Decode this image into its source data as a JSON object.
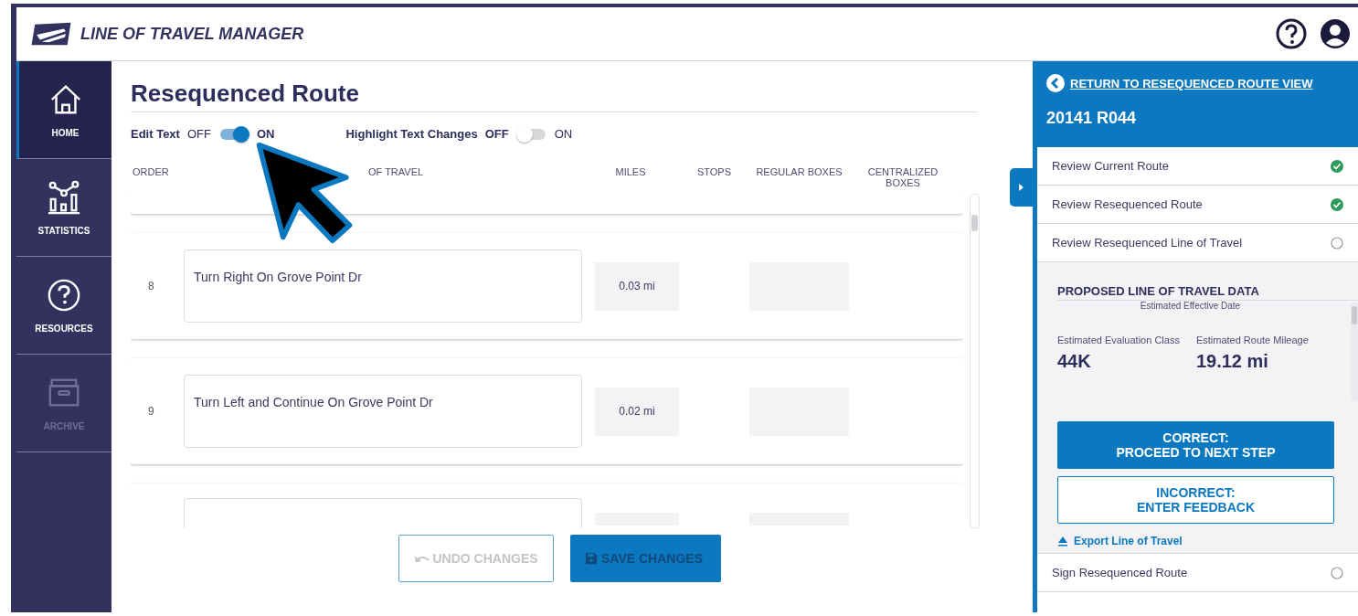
{
  "header": {
    "app_title": "LINE OF TRAVEL MANAGER"
  },
  "sidebar": {
    "items": [
      {
        "label": "HOME",
        "kind": "home",
        "selected": true,
        "disabled": false
      },
      {
        "label": "STATISTICS",
        "kind": "stats",
        "selected": false,
        "disabled": false
      },
      {
        "label": "RESOURCES",
        "kind": "help",
        "selected": false,
        "disabled": false
      },
      {
        "label": "ARCHIVE",
        "kind": "archive",
        "selected": false,
        "disabled": true
      }
    ]
  },
  "main": {
    "title": "Resequenced Route",
    "toggles": [
      {
        "label": "Edit Text",
        "off_label": "OFF",
        "on_label": "ON",
        "on": true
      },
      {
        "label": "Highlight Text Changes",
        "off_label": "OFF",
        "on_label": "ON",
        "on": false
      }
    ],
    "columns": [
      "ORDER",
      "OF TRAVEL",
      "MILES",
      "STOPS",
      "REGULAR BOXES",
      "CENTRALIZED BOXES"
    ],
    "rows": [
      {
        "kind": "partial-top"
      },
      {
        "kind": "full",
        "order": "8",
        "text": "Turn Right On Grove Point Dr",
        "miles": "0.03 mi"
      },
      {
        "kind": "full",
        "order": "9",
        "text": "Turn Left and Continue On Grove Point Dr",
        "miles": "0.02 mi"
      },
      {
        "kind": "partial-bottom"
      }
    ],
    "buttons": [
      {
        "label": "UNDO CHANGES",
        "kind": "undo",
        "disabled": true
      },
      {
        "label": "SAVE CHANGES",
        "kind": "save",
        "disabled": true
      }
    ]
  },
  "panel": {
    "return_link": "RETURN TO RESEQUENCED ROUTE VIEW",
    "route_id": "20141 R044",
    "steps": [
      {
        "label": "Review Current Route",
        "done": true
      },
      {
        "label": "Review Resequenced Route",
        "done": true
      },
      {
        "label": "Review Resequenced Line of Travel",
        "done": false
      }
    ],
    "section_title": "PROPOSED LINE OF TRAVEL DATA",
    "cut_label": "Estimated Effective Date",
    "stats": [
      {
        "label": "Estimated Evaluation Class",
        "value": "44K"
      },
      {
        "label": "Estimated Route Mileage",
        "value": "19.12 mi"
      }
    ],
    "buttons": [
      {
        "kind": "primary",
        "lines": [
          "CORRECT:",
          "PROCEED TO NEXT STEP"
        ]
      },
      {
        "kind": "outline",
        "lines": [
          "INCORRECT:",
          "ENTER FEEDBACK"
        ]
      }
    ],
    "export_link": "Export Line of Travel",
    "last_step": {
      "label": "Sign Resequenced Route",
      "done": false
    }
  }
}
